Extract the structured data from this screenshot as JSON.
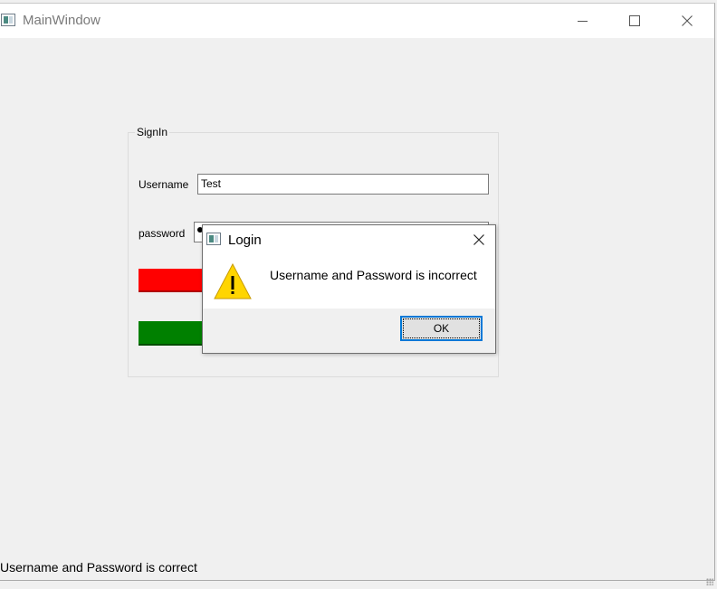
{
  "main_window": {
    "title": "MainWindow",
    "controls": {
      "minimize": "minimize-icon",
      "maximize": "maximize-icon",
      "close": "close-icon"
    }
  },
  "signin": {
    "group_title": "SignIn",
    "username_label": "Username",
    "username_value": "Test",
    "password_label": "password"
  },
  "status_bar": {
    "message": "Username and Password is correct"
  },
  "dialog": {
    "title": "Login",
    "icon": "warning-icon",
    "message": "Username and Password is incorrect",
    "ok_label": "OK"
  },
  "colors": {
    "red_bar": "#ff0000",
    "green_bar": "#008000",
    "ok_focus": "#0078d7",
    "warning": "#ffd500"
  }
}
